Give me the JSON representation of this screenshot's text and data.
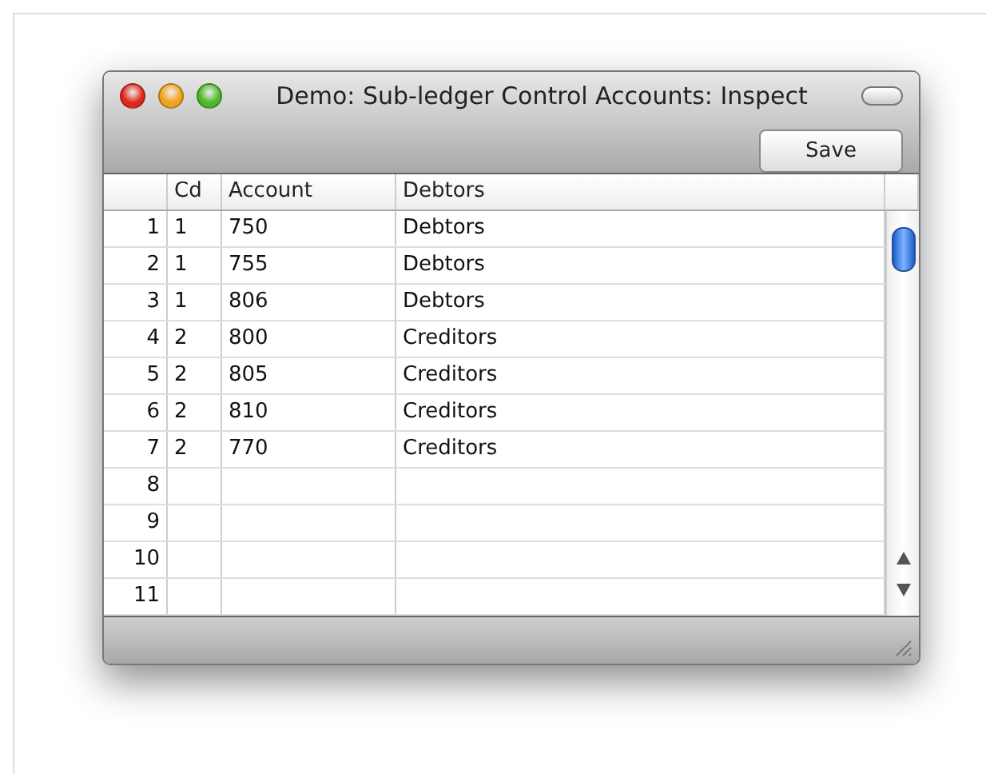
{
  "window": {
    "title": "Demo: Sub-ledger Control Accounts: Inspect"
  },
  "toolbar": {
    "buttons": [
      "Save"
    ]
  },
  "table": {
    "columns": [
      "Cd",
      "Account",
      "Debtors"
    ],
    "rows": [
      {
        "n": "1",
        "cd": "1",
        "account": "750",
        "name": "Debtors"
      },
      {
        "n": "2",
        "cd": "1",
        "account": "755",
        "name": "Debtors"
      },
      {
        "n": "3",
        "cd": "1",
        "account": "806",
        "name": "Debtors"
      },
      {
        "n": "4",
        "cd": "2",
        "account": "800",
        "name": "Creditors"
      },
      {
        "n": "5",
        "cd": "2",
        "account": "805",
        "name": "Creditors"
      },
      {
        "n": "6",
        "cd": "2",
        "account": "810",
        "name": "Creditors"
      },
      {
        "n": "7",
        "cd": "2",
        "account": "770",
        "name": "Creditors"
      },
      {
        "n": "8"
      },
      {
        "n": "9"
      },
      {
        "n": "10"
      },
      {
        "n": "11"
      }
    ]
  }
}
